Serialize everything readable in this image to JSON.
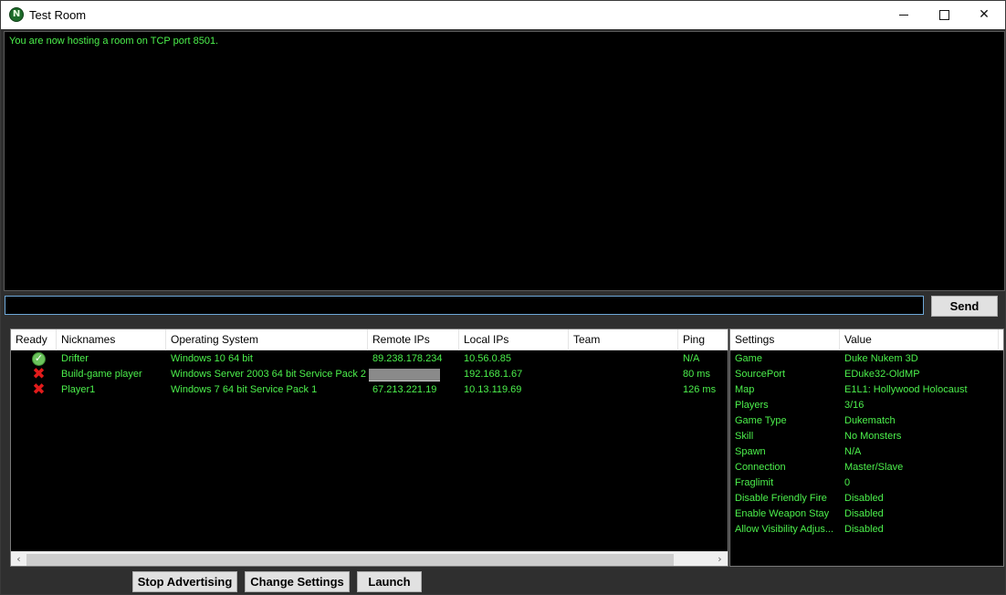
{
  "window": {
    "title": "Test Room",
    "icon_glyph": "N",
    "controls": {
      "minimize": "minimize-icon",
      "maximize": "maximize-icon",
      "close": "close-icon",
      "close_glyph": "✕"
    }
  },
  "log": {
    "lines": [
      "You are now hosting a room on TCP port 8501."
    ]
  },
  "chat": {
    "value": "",
    "send_label": "Send"
  },
  "players": {
    "columns": [
      "Ready",
      "Nicknames",
      "Operating System",
      "Remote IPs",
      "Local IPs",
      "Team",
      "Ping"
    ],
    "rows": [
      {
        "ready": "ready",
        "ready_icon": "check-icon",
        "nickname": "Drifter",
        "os": "Windows 10 64 bit",
        "remote_ip": "89.238.178.234",
        "local_ip": "10.56.0.85",
        "team": "",
        "ping": "N/A"
      },
      {
        "ready": "not-ready",
        "ready_icon": "x-icon",
        "nickname": "Build-game player",
        "os": "Windows Server 2003 64 bit Service Pack 2",
        "remote_ip": "",
        "remote_ip_redacted": true,
        "local_ip": "192.168.1.67",
        "team": "",
        "ping": "80 ms"
      },
      {
        "ready": "not-ready",
        "ready_icon": "x-icon",
        "nickname": "Player1",
        "os": "Windows 7 64 bit Service Pack 1",
        "remote_ip": "67.213.221.19",
        "local_ip": "10.13.119.69",
        "team": "",
        "ping": "126 ms"
      }
    ],
    "scroll_left": "‹",
    "scroll_right": "›"
  },
  "settings": {
    "columns": [
      "Settings",
      "Value"
    ],
    "rows": [
      {
        "key": "Game",
        "value": "Duke Nukem 3D"
      },
      {
        "key": "SourcePort",
        "value": "EDuke32-OldMP"
      },
      {
        "key": "Map",
        "value": "E1L1: Hollywood Holocaust"
      },
      {
        "key": "Players",
        "value": "3/16"
      },
      {
        "key": "Game Type",
        "value": "Dukematch"
      },
      {
        "key": "Skill",
        "value": "No Monsters"
      },
      {
        "key": "Spawn",
        "value": "N/A"
      },
      {
        "key": "Connection",
        "value": "Master/Slave"
      },
      {
        "key": "Fraglimit",
        "value": "0"
      },
      {
        "key": "Disable Friendly Fire",
        "value": "Disabled"
      },
      {
        "key": "Enable Weapon Stay",
        "value": "Disabled"
      },
      {
        "key": "Allow Visibility Adjus...",
        "value": "Disabled"
      }
    ]
  },
  "actions": {
    "stop_advertising": "Stop Advertising",
    "change_settings": "Change Settings",
    "launch": "Launch"
  },
  "colors": {
    "text_green": "#4cf04c",
    "background": "#000000",
    "window_bg": "#2f2f2f"
  }
}
